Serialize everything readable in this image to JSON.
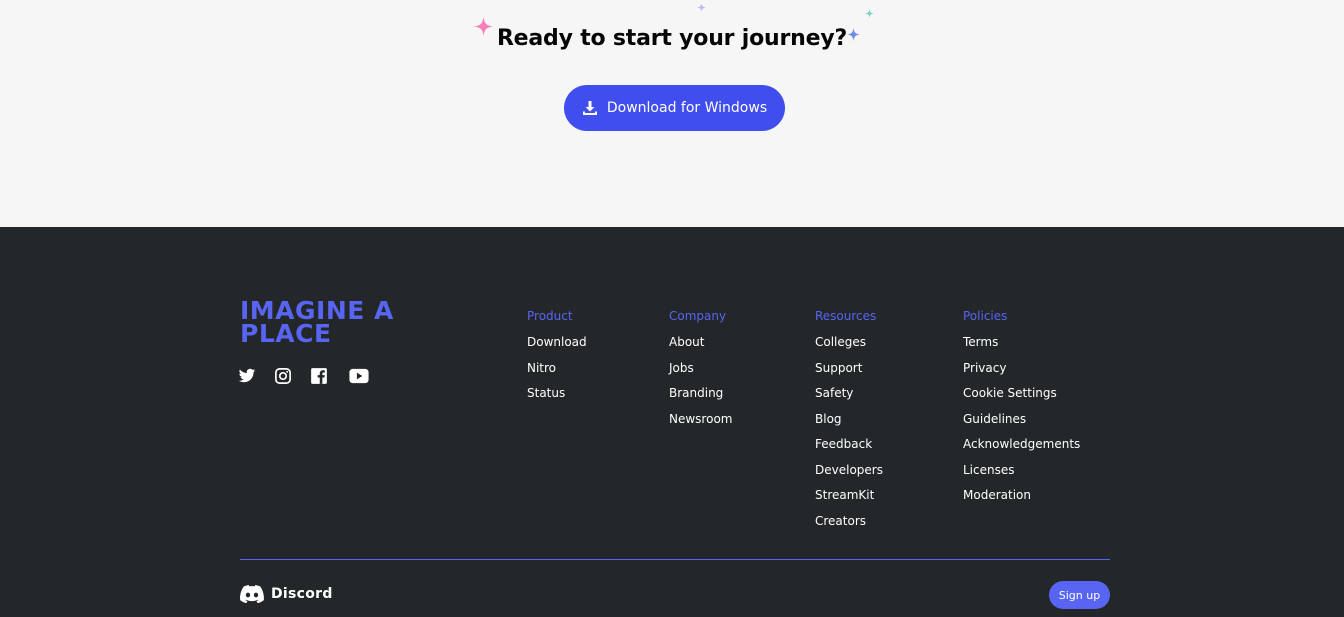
{
  "cta": {
    "title": "Ready to start your journey?",
    "download_label": "Download for Windows"
  },
  "footer": {
    "tagline": "IMAGINE A PLACE",
    "socials": [
      "twitter-icon",
      "instagram-icon",
      "facebook-icon",
      "youtube-icon"
    ],
    "columns": [
      {
        "heading": "Product",
        "links": [
          "Download",
          "Nitro",
          "Status"
        ]
      },
      {
        "heading": "Company",
        "links": [
          "About",
          "Jobs",
          "Branding",
          "Newsroom"
        ]
      },
      {
        "heading": "Resources",
        "links": [
          "Colleges",
          "Support",
          "Safety",
          "Blog",
          "Feedback",
          "Developers",
          "StreamKit",
          "Creators"
        ]
      },
      {
        "heading": "Policies",
        "links": [
          "Terms",
          "Privacy",
          "Cookie Settings",
          "Guidelines",
          "Acknowledgements",
          "Licenses",
          "Moderation"
        ]
      }
    ],
    "brand_name": "Discord",
    "signup_label": "Sign up"
  },
  "colors": {
    "blurple": "#5865f2",
    "button_blue": "#404eed",
    "footer_bg": "#23272a",
    "cta_bg": "#f6f6f6"
  }
}
